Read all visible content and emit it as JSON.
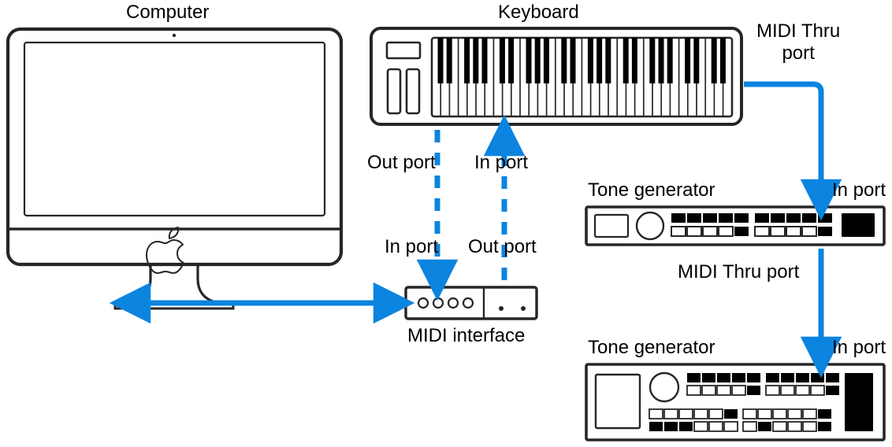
{
  "diagram": {
    "labels": {
      "computer": "Computer",
      "keyboard": "Keyboard",
      "midi_thru_1": "MIDI Thru\nport",
      "out_port_1": "Out port",
      "in_port_1": "In port",
      "in_port_2": "In port",
      "out_port_2": "Out port",
      "midi_interface": "MIDI interface",
      "tone_gen_1": "Tone generator",
      "tg1_in_port": "In port",
      "midi_thru_2": "MIDI Thru port",
      "tone_gen_2": "Tone generator",
      "tg2_in_port": "In port"
    },
    "colors": {
      "arrow": "#0b84e0",
      "device_stroke": "#262626",
      "piano_black": "#000000"
    }
  }
}
